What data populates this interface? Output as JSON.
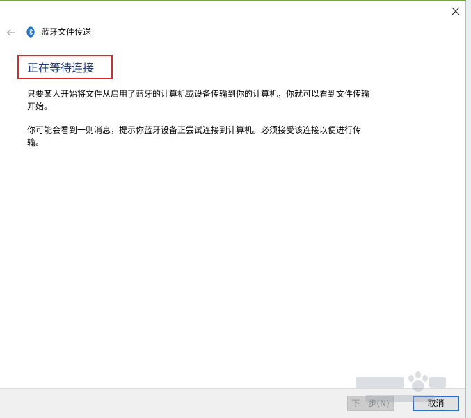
{
  "window": {
    "title": "蓝牙文件传送"
  },
  "content": {
    "heading": "正在等待连接",
    "paragraph1": "只要某人开始将文件从启用了蓝牙的计算机或设备传输到你的计算机，你就可以看到文件传输开始。",
    "paragraph2": "你可能会看到一则消息，提示你蓝牙设备正尝试连接到计算机。必须接受该连接以便进行传输。"
  },
  "footer": {
    "next_label": "下一步(N)",
    "cancel_label": "取消"
  },
  "icons": {
    "back": "back-arrow-icon",
    "close": "close-icon",
    "bluetooth": "bluetooth-icon"
  },
  "colors": {
    "heading": "#1b3a8a",
    "highlight_border": "#e0262c",
    "bluetooth_badge": "#1a73d9",
    "cancel_border": "#2b6fd1",
    "accent_strip": "#7aa33b"
  }
}
